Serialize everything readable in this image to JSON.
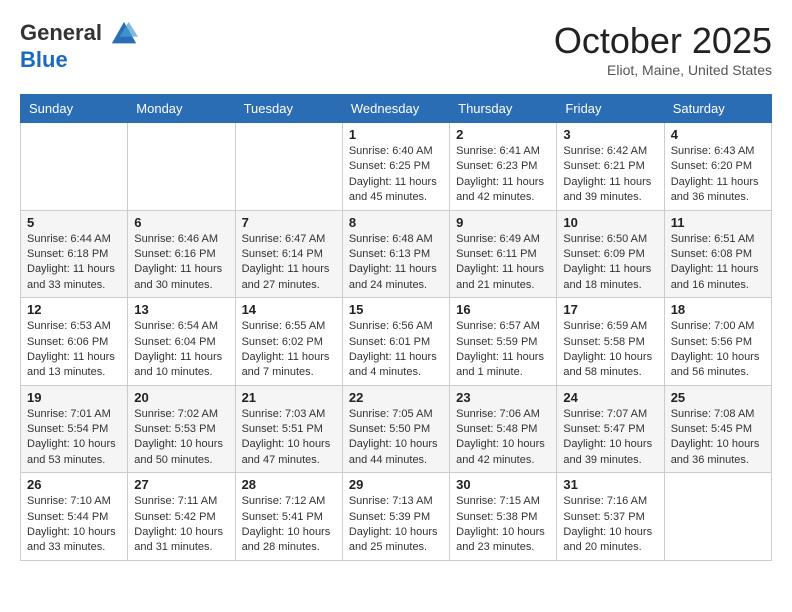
{
  "header": {
    "logo_line1": "General",
    "logo_line2": "Blue",
    "month": "October 2025",
    "location": "Eliot, Maine, United States"
  },
  "weekdays": [
    "Sunday",
    "Monday",
    "Tuesday",
    "Wednesday",
    "Thursday",
    "Friday",
    "Saturday"
  ],
  "weeks": [
    [
      {
        "day": "",
        "sunrise": "",
        "sunset": "",
        "daylight": ""
      },
      {
        "day": "",
        "sunrise": "",
        "sunset": "",
        "daylight": ""
      },
      {
        "day": "",
        "sunrise": "",
        "sunset": "",
        "daylight": ""
      },
      {
        "day": "1",
        "sunrise": "Sunrise: 6:40 AM",
        "sunset": "Sunset: 6:25 PM",
        "daylight": "Daylight: 11 hours and 45 minutes."
      },
      {
        "day": "2",
        "sunrise": "Sunrise: 6:41 AM",
        "sunset": "Sunset: 6:23 PM",
        "daylight": "Daylight: 11 hours and 42 minutes."
      },
      {
        "day": "3",
        "sunrise": "Sunrise: 6:42 AM",
        "sunset": "Sunset: 6:21 PM",
        "daylight": "Daylight: 11 hours and 39 minutes."
      },
      {
        "day": "4",
        "sunrise": "Sunrise: 6:43 AM",
        "sunset": "Sunset: 6:20 PM",
        "daylight": "Daylight: 11 hours and 36 minutes."
      }
    ],
    [
      {
        "day": "5",
        "sunrise": "Sunrise: 6:44 AM",
        "sunset": "Sunset: 6:18 PM",
        "daylight": "Daylight: 11 hours and 33 minutes."
      },
      {
        "day": "6",
        "sunrise": "Sunrise: 6:46 AM",
        "sunset": "Sunset: 6:16 PM",
        "daylight": "Daylight: 11 hours and 30 minutes."
      },
      {
        "day": "7",
        "sunrise": "Sunrise: 6:47 AM",
        "sunset": "Sunset: 6:14 PM",
        "daylight": "Daylight: 11 hours and 27 minutes."
      },
      {
        "day": "8",
        "sunrise": "Sunrise: 6:48 AM",
        "sunset": "Sunset: 6:13 PM",
        "daylight": "Daylight: 11 hours and 24 minutes."
      },
      {
        "day": "9",
        "sunrise": "Sunrise: 6:49 AM",
        "sunset": "Sunset: 6:11 PM",
        "daylight": "Daylight: 11 hours and 21 minutes."
      },
      {
        "day": "10",
        "sunrise": "Sunrise: 6:50 AM",
        "sunset": "Sunset: 6:09 PM",
        "daylight": "Daylight: 11 hours and 18 minutes."
      },
      {
        "day": "11",
        "sunrise": "Sunrise: 6:51 AM",
        "sunset": "Sunset: 6:08 PM",
        "daylight": "Daylight: 11 hours and 16 minutes."
      }
    ],
    [
      {
        "day": "12",
        "sunrise": "Sunrise: 6:53 AM",
        "sunset": "Sunset: 6:06 PM",
        "daylight": "Daylight: 11 hours and 13 minutes."
      },
      {
        "day": "13",
        "sunrise": "Sunrise: 6:54 AM",
        "sunset": "Sunset: 6:04 PM",
        "daylight": "Daylight: 11 hours and 10 minutes."
      },
      {
        "day": "14",
        "sunrise": "Sunrise: 6:55 AM",
        "sunset": "Sunset: 6:02 PM",
        "daylight": "Daylight: 11 hours and 7 minutes."
      },
      {
        "day": "15",
        "sunrise": "Sunrise: 6:56 AM",
        "sunset": "Sunset: 6:01 PM",
        "daylight": "Daylight: 11 hours and 4 minutes."
      },
      {
        "day": "16",
        "sunrise": "Sunrise: 6:57 AM",
        "sunset": "Sunset: 5:59 PM",
        "daylight": "Daylight: 11 hours and 1 minute."
      },
      {
        "day": "17",
        "sunrise": "Sunrise: 6:59 AM",
        "sunset": "Sunset: 5:58 PM",
        "daylight": "Daylight: 10 hours and 58 minutes."
      },
      {
        "day": "18",
        "sunrise": "Sunrise: 7:00 AM",
        "sunset": "Sunset: 5:56 PM",
        "daylight": "Daylight: 10 hours and 56 minutes."
      }
    ],
    [
      {
        "day": "19",
        "sunrise": "Sunrise: 7:01 AM",
        "sunset": "Sunset: 5:54 PM",
        "daylight": "Daylight: 10 hours and 53 minutes."
      },
      {
        "day": "20",
        "sunrise": "Sunrise: 7:02 AM",
        "sunset": "Sunset: 5:53 PM",
        "daylight": "Daylight: 10 hours and 50 minutes."
      },
      {
        "day": "21",
        "sunrise": "Sunrise: 7:03 AM",
        "sunset": "Sunset: 5:51 PM",
        "daylight": "Daylight: 10 hours and 47 minutes."
      },
      {
        "day": "22",
        "sunrise": "Sunrise: 7:05 AM",
        "sunset": "Sunset: 5:50 PM",
        "daylight": "Daylight: 10 hours and 44 minutes."
      },
      {
        "day": "23",
        "sunrise": "Sunrise: 7:06 AM",
        "sunset": "Sunset: 5:48 PM",
        "daylight": "Daylight: 10 hours and 42 minutes."
      },
      {
        "day": "24",
        "sunrise": "Sunrise: 7:07 AM",
        "sunset": "Sunset: 5:47 PM",
        "daylight": "Daylight: 10 hours and 39 minutes."
      },
      {
        "day": "25",
        "sunrise": "Sunrise: 7:08 AM",
        "sunset": "Sunset: 5:45 PM",
        "daylight": "Daylight: 10 hours and 36 minutes."
      }
    ],
    [
      {
        "day": "26",
        "sunrise": "Sunrise: 7:10 AM",
        "sunset": "Sunset: 5:44 PM",
        "daylight": "Daylight: 10 hours and 33 minutes."
      },
      {
        "day": "27",
        "sunrise": "Sunrise: 7:11 AM",
        "sunset": "Sunset: 5:42 PM",
        "daylight": "Daylight: 10 hours and 31 minutes."
      },
      {
        "day": "28",
        "sunrise": "Sunrise: 7:12 AM",
        "sunset": "Sunset: 5:41 PM",
        "daylight": "Daylight: 10 hours and 28 minutes."
      },
      {
        "day": "29",
        "sunrise": "Sunrise: 7:13 AM",
        "sunset": "Sunset: 5:39 PM",
        "daylight": "Daylight: 10 hours and 25 minutes."
      },
      {
        "day": "30",
        "sunrise": "Sunrise: 7:15 AM",
        "sunset": "Sunset: 5:38 PM",
        "daylight": "Daylight: 10 hours and 23 minutes."
      },
      {
        "day": "31",
        "sunrise": "Sunrise: 7:16 AM",
        "sunset": "Sunset: 5:37 PM",
        "daylight": "Daylight: 10 hours and 20 minutes."
      },
      {
        "day": "",
        "sunrise": "",
        "sunset": "",
        "daylight": ""
      }
    ]
  ]
}
